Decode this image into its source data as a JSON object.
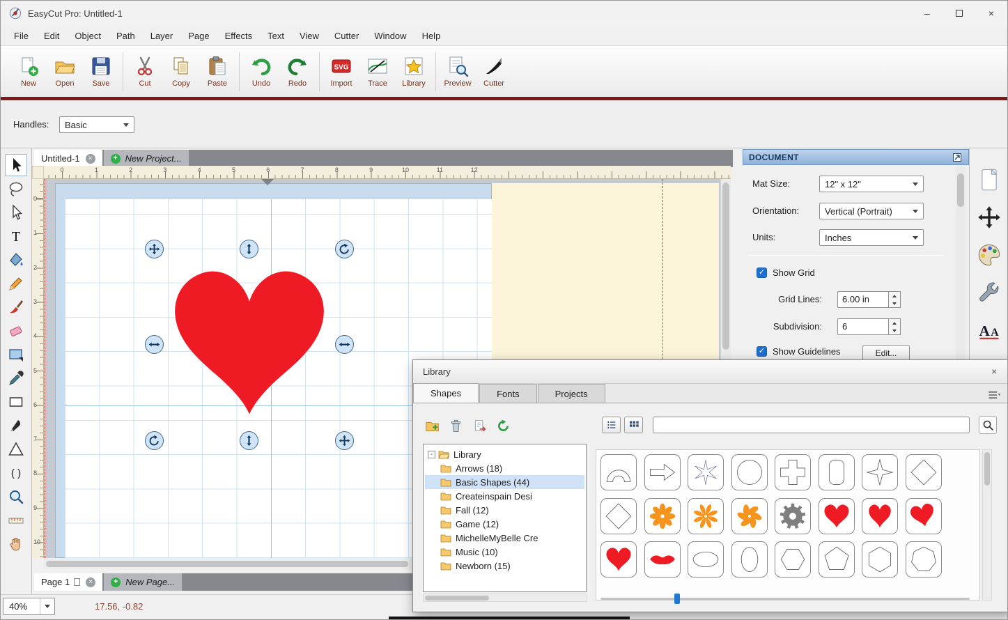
{
  "titlebar": {
    "title": "EasyCut Pro: Untitled-1"
  },
  "glyphs": {
    "check": "✓",
    "close": "×",
    "plus": "+",
    "minimize": "–",
    "collapse": "-"
  },
  "menu": {
    "items": [
      "File",
      "Edit",
      "Object",
      "Path",
      "Layer",
      "Page",
      "Effects",
      "Text",
      "View",
      "Cutter",
      "Window",
      "Help"
    ]
  },
  "toolbar": {
    "buttons": [
      {
        "label": "New",
        "icon": "tnew"
      },
      {
        "label": "Open",
        "icon": "topen"
      },
      {
        "label": "Save",
        "icon": "tsave",
        "sep": true
      },
      {
        "label": "Cut",
        "icon": "tcut"
      },
      {
        "label": "Copy",
        "icon": "tcopy"
      },
      {
        "label": "Paste",
        "icon": "tpaste",
        "sep": true
      },
      {
        "label": "Undo",
        "icon": "tundo"
      },
      {
        "label": "Redo",
        "icon": "tredo",
        "sep": true
      },
      {
        "label": "Import",
        "icon": "timport"
      },
      {
        "label": "Trace",
        "icon": "ttrace"
      },
      {
        "label": "Library",
        "icon": "tlibrary",
        "sep": true
      },
      {
        "label": "Preview",
        "icon": "tpreview"
      },
      {
        "label": "Cutter",
        "icon": "tcutter"
      }
    ]
  },
  "handles_bar": {
    "label": "Handles:",
    "value": "Basic"
  },
  "tools": [
    {
      "name": "select",
      "icon": "cursor",
      "selected": true
    },
    {
      "name": "shape-select",
      "icon": "lasso"
    },
    {
      "name": "node-edit",
      "icon": "nodecursor"
    },
    {
      "name": "text",
      "icon": "text"
    },
    {
      "name": "fill",
      "icon": "fill"
    },
    {
      "name": "pencil",
      "icon": "pencil"
    },
    {
      "name": "brush",
      "icon": "brush"
    },
    {
      "name": "eraser",
      "icon": "eraser"
    },
    {
      "name": "shapes",
      "icon": "shaperect"
    },
    {
      "name": "eyedropper",
      "icon": "eyedropper"
    },
    {
      "name": "rectangle",
      "icon": "rectoutline"
    },
    {
      "name": "knife",
      "icon": "knife"
    },
    {
      "name": "polygon",
      "icon": "polygon"
    },
    {
      "name": "brackets",
      "icon": "brackets"
    },
    {
      "name": "zoom",
      "icon": "zoom"
    },
    {
      "name": "measure",
      "icon": "measure"
    },
    {
      "name": "pan",
      "icon": "hand"
    }
  ],
  "tabs": {
    "document": "Untitled-1",
    "new_project": "New Project...",
    "page": "Page 1",
    "new_page": "New Page..."
  },
  "rulers": {
    "horizontal": [
      "0",
      "1",
      "2",
      "3",
      "4",
      "5",
      "6",
      "7",
      "8",
      "9",
      "10",
      "11",
      "12"
    ],
    "vertical": [
      "0",
      "1",
      "2",
      "3",
      "4",
      "5",
      "6",
      "7",
      "8",
      "9",
      "10"
    ]
  },
  "document_panel": {
    "title": "DOCUMENT",
    "mat_size_label": "Mat Size:",
    "mat_size_value": "12\" x 12\"",
    "orientation_label": "Orientation:",
    "orientation_value": "Vertical (Portrait)",
    "units_label": "Units:",
    "units_value": "Inches",
    "show_grid": "Show Grid",
    "grid_lines_label": "Grid Lines:",
    "grid_lines_value": "6.00 in",
    "subdivision_label": "Subdivision:",
    "subdivision_value": "6",
    "show_guidelines": "Show Guidelines",
    "edit_button": "Edit..."
  },
  "right_panel_tools": [
    {
      "name": "document",
      "icon": "rpage"
    },
    {
      "name": "move",
      "icon": "rmove"
    },
    {
      "name": "colors",
      "icon": "rpalette"
    },
    {
      "name": "tools",
      "icon": "rwrench"
    },
    {
      "name": "fonts",
      "icon": "rfonts"
    }
  ],
  "library": {
    "title": "Library",
    "tabs": [
      {
        "label": "Shapes"
      },
      {
        "label": "Fonts"
      },
      {
        "label": "Projects"
      }
    ],
    "tree_root": "Library",
    "selected_index": 1,
    "tree_items": [
      "Arrows (18)",
      "Basic Shapes (44)",
      "Createinspain Desi",
      "Fall (12)",
      "Game (12)",
      "MichelleMyBelle Cre",
      "Music (10)",
      "Newborn (15)"
    ],
    "shapes": [
      {
        "name": "arch",
        "type": "arch"
      },
      {
        "name": "arrow-right",
        "type": "arrow-right"
      },
      {
        "name": "asterisk",
        "type": "asterisk"
      },
      {
        "name": "circle",
        "type": "circle"
      },
      {
        "name": "cross",
        "type": "cross"
      },
      {
        "name": "rounded-rectangle",
        "type": "rounded-rect"
      },
      {
        "name": "star-4-point",
        "type": "star4"
      },
      {
        "name": "diamond",
        "type": "diamond"
      },
      {
        "name": "diamond-2",
        "type": "diamond"
      },
      {
        "name": "flower-1",
        "type": "flower",
        "color": "#f7941d"
      },
      {
        "name": "flower-2",
        "type": "daisy",
        "color": "#f7941d"
      },
      {
        "name": "flower-3",
        "type": "pinwheel",
        "color": "#f7941d"
      },
      {
        "name": "gear",
        "type": "gear",
        "color": "#7f7f7f"
      },
      {
        "name": "heart-1",
        "type": "heart",
        "color": "#ee1b24"
      },
      {
        "name": "heart-2",
        "type": "heart2",
        "color": "#ee1b24"
      },
      {
        "name": "heart-3",
        "type": "heart3",
        "color": "#ee1b24"
      },
      {
        "name": "heart-4",
        "type": "heart",
        "color": "#ee1b24"
      },
      {
        "name": "lips",
        "type": "lips",
        "color": "#ee1b24"
      },
      {
        "name": "ellipse",
        "type": "ellipse"
      },
      {
        "name": "oval",
        "type": "oval"
      },
      {
        "name": "rounded-hexagon",
        "type": "hexagon-rounded"
      },
      {
        "name": "pentagon",
        "type": "pentagon"
      },
      {
        "name": "hexagon",
        "type": "hexagon"
      },
      {
        "name": "heptagon",
        "type": "heptagon"
      }
    ]
  },
  "status_bar": {
    "zoom": "40%",
    "coordinates": "17.56, -0.82"
  },
  "colors": {
    "heart": "#ee1b24",
    "flower": "#f7941d",
    "gear": "#7f7f7f",
    "accent": "#7d1a1a"
  }
}
